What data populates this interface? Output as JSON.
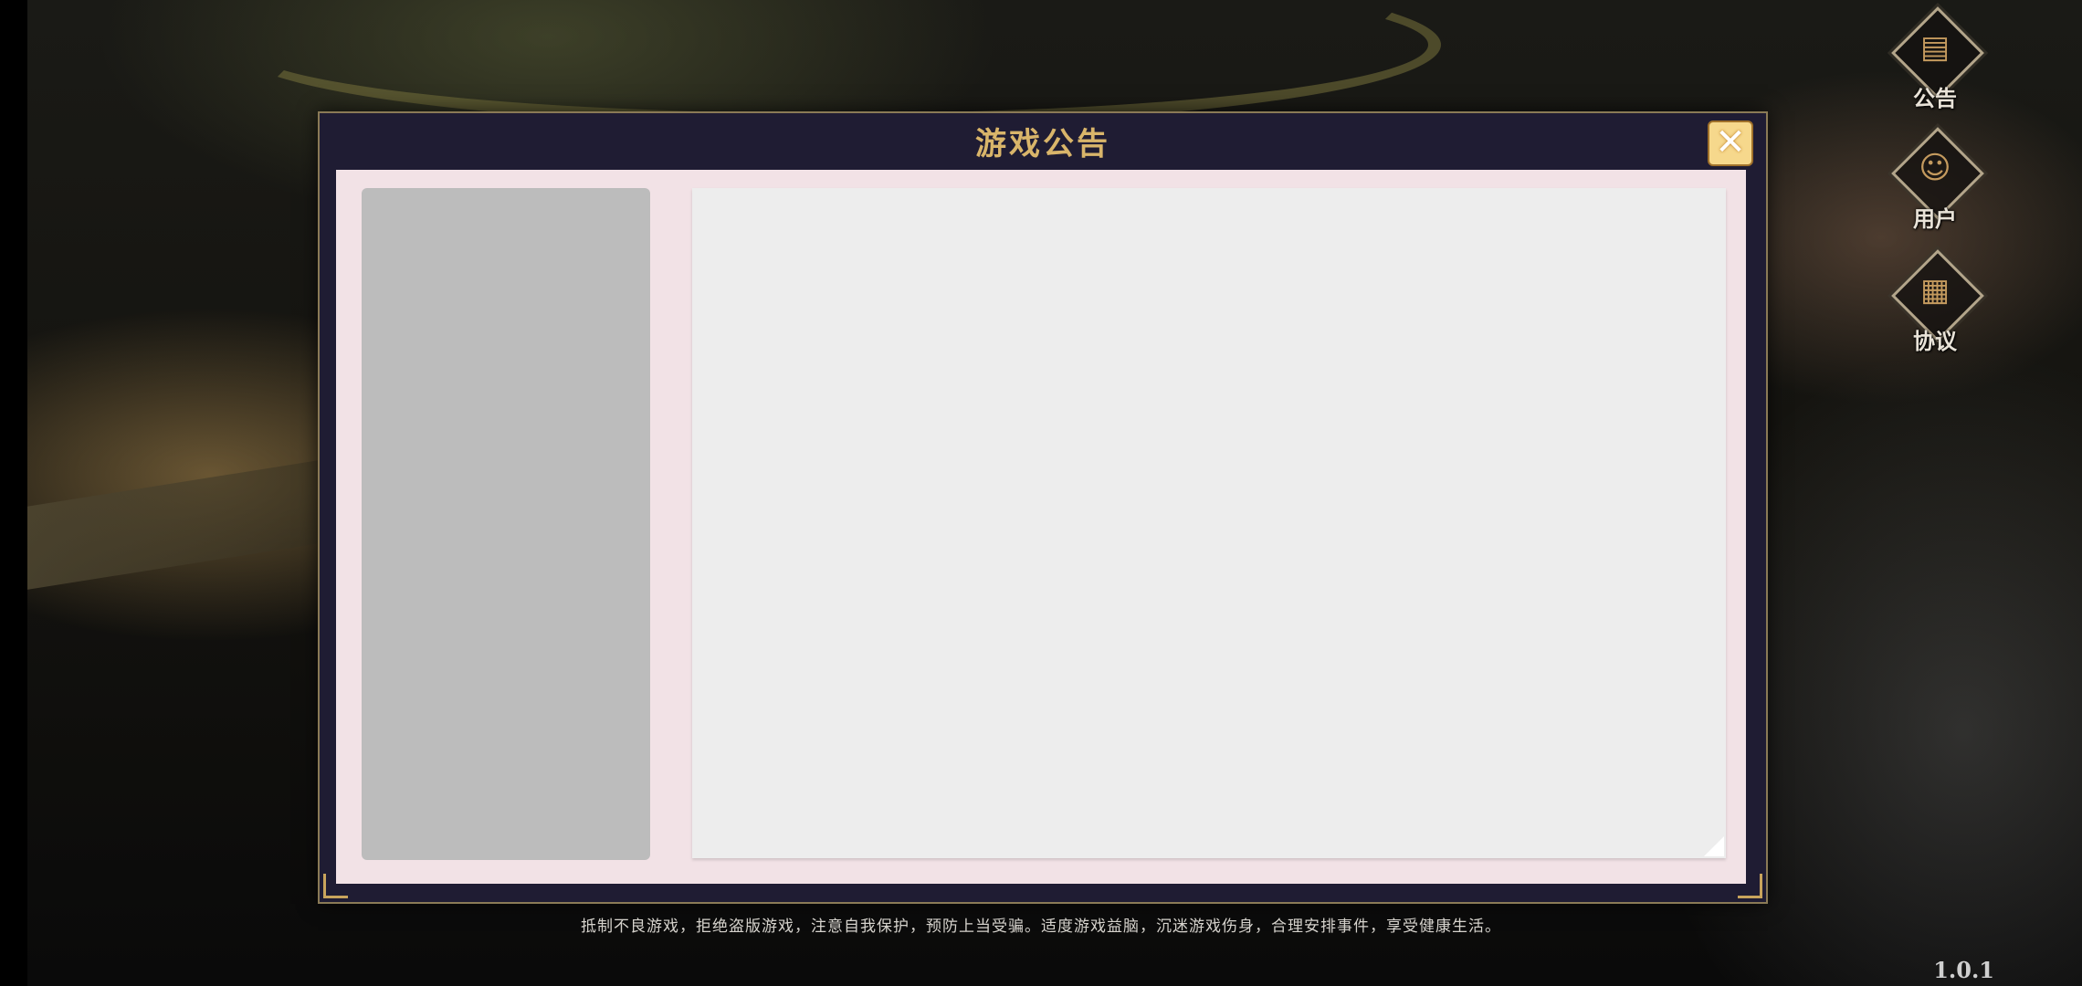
{
  "dialog": {
    "title": "游戏公告",
    "close_label": "✕"
  },
  "side_menu": [
    {
      "label": "公告",
      "icon": "notice-board-icon",
      "glyph": "▤"
    },
    {
      "label": "用户",
      "icon": "user-portrait-icon",
      "glyph": "☺"
    },
    {
      "label": "协议",
      "icon": "document-icon",
      "glyph": "▦"
    }
  ],
  "footer": {
    "notice": "抵制不良游戏，拒绝盗版游戏，注意自我保护，预防上当受骗。适度游戏益脑，沉迷游戏伤身，合理安排事件，享受健康生活。",
    "version": "1.0.1"
  },
  "colors": {
    "title_gold": "#d9b56a",
    "dialog_frame": "#1f1c33",
    "panel_pink": "#f2e2e6",
    "list_gray": "#bcbcbc",
    "content_white": "#ededed"
  }
}
